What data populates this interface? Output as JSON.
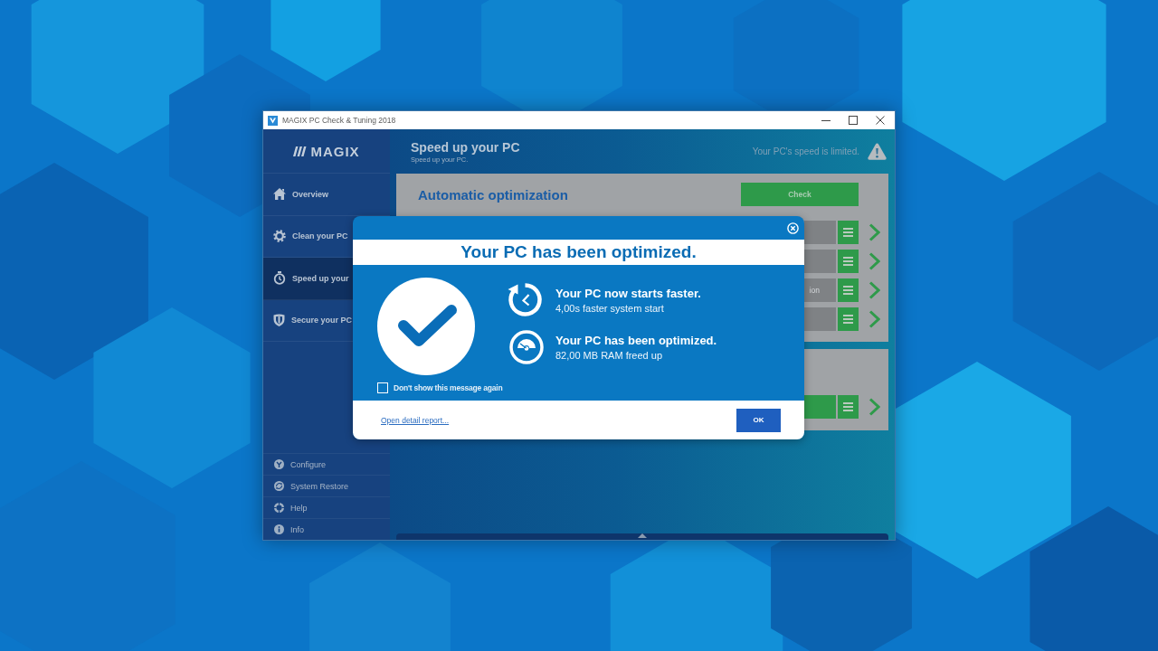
{
  "window": {
    "title": "MAGIX PC Check & Tuning 2018"
  },
  "sidebar": {
    "logo": "MAGIX",
    "items": [
      {
        "label": "Overview",
        "selected": false
      },
      {
        "label": "Clean your PC",
        "selected": false
      },
      {
        "label": "Speed up your",
        "selected": true
      },
      {
        "label": "Secure your PC",
        "selected": false
      }
    ],
    "footer_items": [
      {
        "label": "Configure"
      },
      {
        "label": "System Restore"
      },
      {
        "label": "Help"
      },
      {
        "label": "Info"
      }
    ]
  },
  "header": {
    "title": "Speed up your PC",
    "subtitle": "Speed up your PC.",
    "status": "Your PC's speed is limited."
  },
  "panels": [
    {
      "title": "Automatic optimization",
      "button": "Check",
      "rows": [
        {
          "highlighted": false
        },
        {
          "highlighted": false
        },
        {
          "label": "ion",
          "highlighted": false
        },
        {
          "highlighted": false
        }
      ]
    },
    {
      "rows": [
        {
          "highlighted": true
        }
      ]
    }
  ],
  "dialog": {
    "title": "Your PC has been optimized.",
    "results": [
      {
        "title": "Your PC now starts faster.",
        "detail": "4,00s faster system start"
      },
      {
        "title": "Your PC has been optimized.",
        "detail": "82,00 MB RAM freed up"
      }
    ],
    "dont_show_again": {
      "label": "Don't show this message again",
      "checked": false
    },
    "link": "Open detail report...",
    "ok_button": "OK"
  }
}
